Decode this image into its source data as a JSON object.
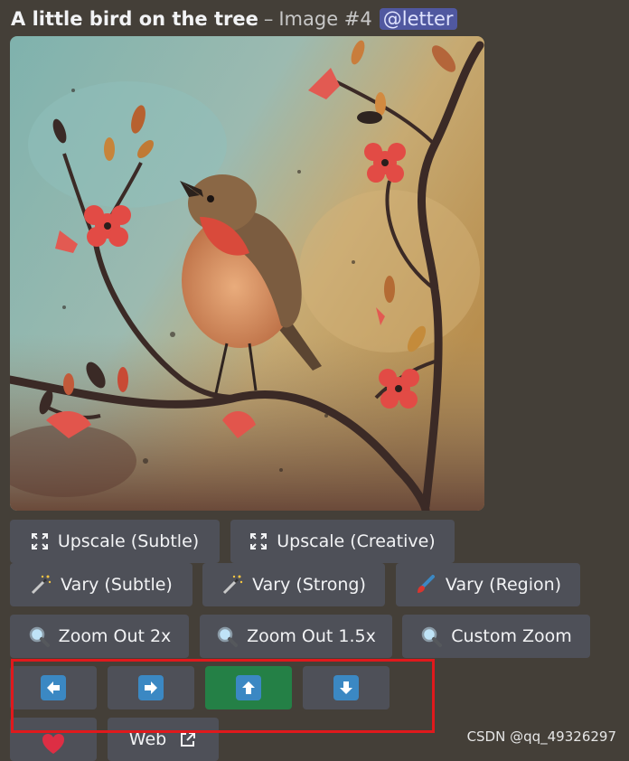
{
  "message": {
    "prompt": "A little bird on the tree",
    "separator": "–",
    "image_label": "Image #4",
    "mention": "@letter"
  },
  "image": {
    "subject": "painting of a robin perched on a branch with red flowers on a teal and ochre textured background"
  },
  "buttons": {
    "upscale_subtle": "Upscale (Subtle)",
    "upscale_creative": "Upscale (Creative)",
    "vary_subtle": "Vary (Subtle)",
    "vary_strong": "Vary (Strong)",
    "vary_region": "Vary (Region)",
    "zoom_out_2x": "Zoom Out 2x",
    "zoom_out_1_5x": "Zoom Out 1.5x",
    "custom_zoom": "Custom Zoom",
    "web": "Web"
  },
  "pan_buttons": [
    {
      "direction": "left",
      "icon": "arrow-left-icon",
      "active": false
    },
    {
      "direction": "right",
      "icon": "arrow-right-icon",
      "active": false
    },
    {
      "direction": "up",
      "icon": "arrow-up-icon",
      "active": true
    },
    {
      "direction": "down",
      "icon": "arrow-down-icon",
      "active": false
    }
  ],
  "colors": {
    "background": "#443f38",
    "button": "#4e5058",
    "button_active": "#248046",
    "arrow_icon": "#3b88c3",
    "highlight_box": "#e0191c",
    "mention_bg": "#5058a0"
  },
  "watermark": "CSDN @qq_49326297"
}
